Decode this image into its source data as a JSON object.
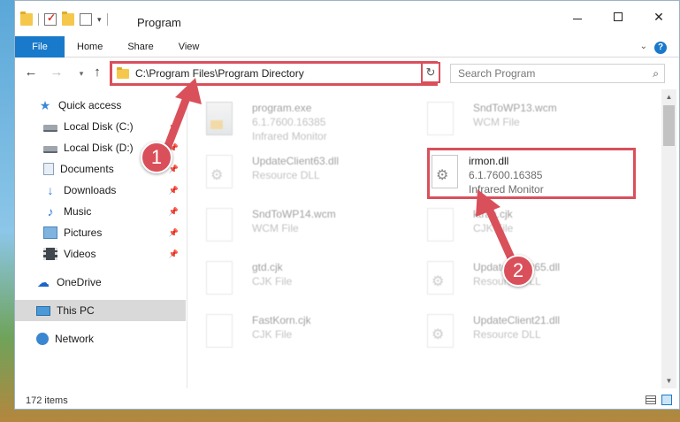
{
  "window": {
    "title": "Program"
  },
  "ribbon": {
    "tabs": [
      "File",
      "Home",
      "Share",
      "View"
    ],
    "help_symbol": "?"
  },
  "address": {
    "path": "C:\\Program Files\\Program Directory"
  },
  "search": {
    "placeholder": "Search Program"
  },
  "sidebar": {
    "items": [
      {
        "label": "Quick access"
      },
      {
        "label": "Local Disk (C:)"
      },
      {
        "label": "Local Disk (D:)"
      },
      {
        "label": "Documents"
      },
      {
        "label": "Downloads"
      },
      {
        "label": "Music"
      },
      {
        "label": "Pictures"
      },
      {
        "label": "Videos"
      },
      {
        "label": "OneDrive"
      },
      {
        "label": "This PC"
      },
      {
        "label": "Network"
      }
    ]
  },
  "files": [
    {
      "name": "program.exe",
      "line2": "6.1.7600.16385",
      "line3": "Infrared Monitor"
    },
    {
      "name": "SndToWP13.wcm",
      "line2": "WCM File",
      "line3": ""
    },
    {
      "name": "UpdateClient63.dll",
      "line2": "Resource DLL",
      "line3": ""
    },
    {
      "name": "irmon.dll",
      "line2": "6.1.7600.16385",
      "line3": "Infrared Monitor"
    },
    {
      "name": "SndToWP14.wcm",
      "line2": "WCM File",
      "line3": ""
    },
    {
      "name": "ktran.cjk",
      "line2": "CJK File",
      "line3": ""
    },
    {
      "name": "gtd.cjk",
      "line2": "CJK File",
      "line3": ""
    },
    {
      "name": "UpdateClient65.dll",
      "line2": "Resource DLL",
      "line3": ""
    },
    {
      "name": "FastKorn.cjk",
      "line2": "CJK File",
      "line3": ""
    },
    {
      "name": "UpdateClient21.dll",
      "line2": "Resource DLL",
      "line3": ""
    }
  ],
  "status": {
    "item_count": "172 items"
  },
  "annotations": {
    "step1": "1",
    "step2": "2",
    "color": "#d9505b"
  }
}
